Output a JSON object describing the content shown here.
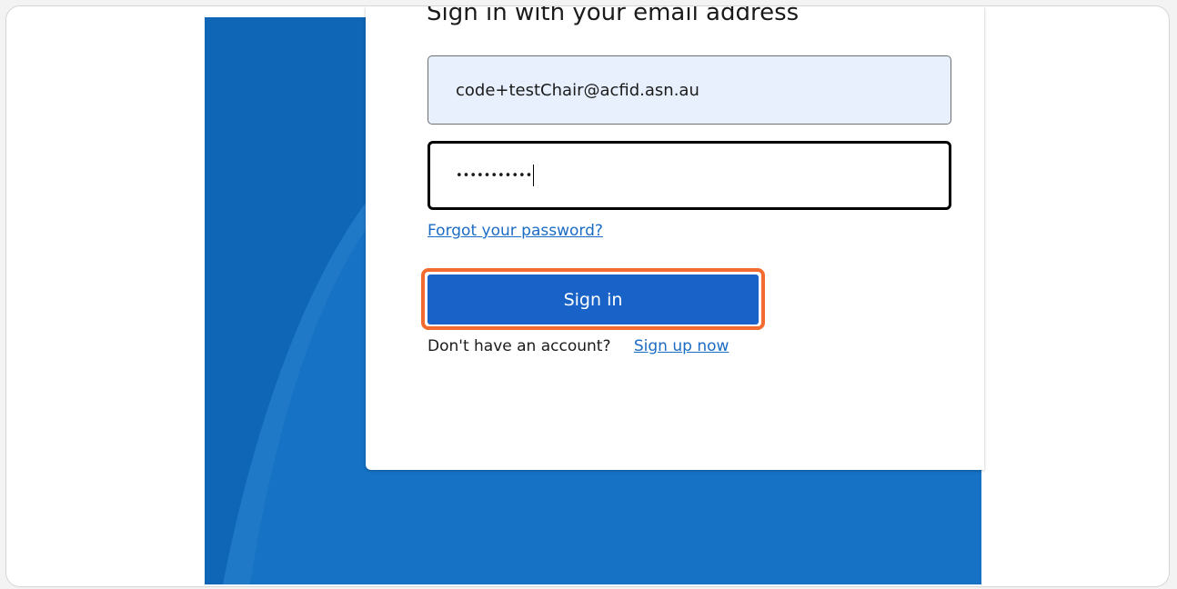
{
  "heading": "Sign in with your email address",
  "email": {
    "value": "code+testChair@acfid.asn.au"
  },
  "password": {
    "masked_value": "•••••••••••"
  },
  "forgot_password_link": "Forgot your password?",
  "signin_button": "Sign in",
  "signup": {
    "prompt": "Don't have an account?",
    "link": "Sign up now"
  },
  "colors": {
    "background_blue": "#1572c4",
    "button_blue": "#1963c8",
    "link_blue": "#1b6cc4",
    "highlight_orange": "#f26b2f",
    "email_fill": "#e8f0fe"
  }
}
